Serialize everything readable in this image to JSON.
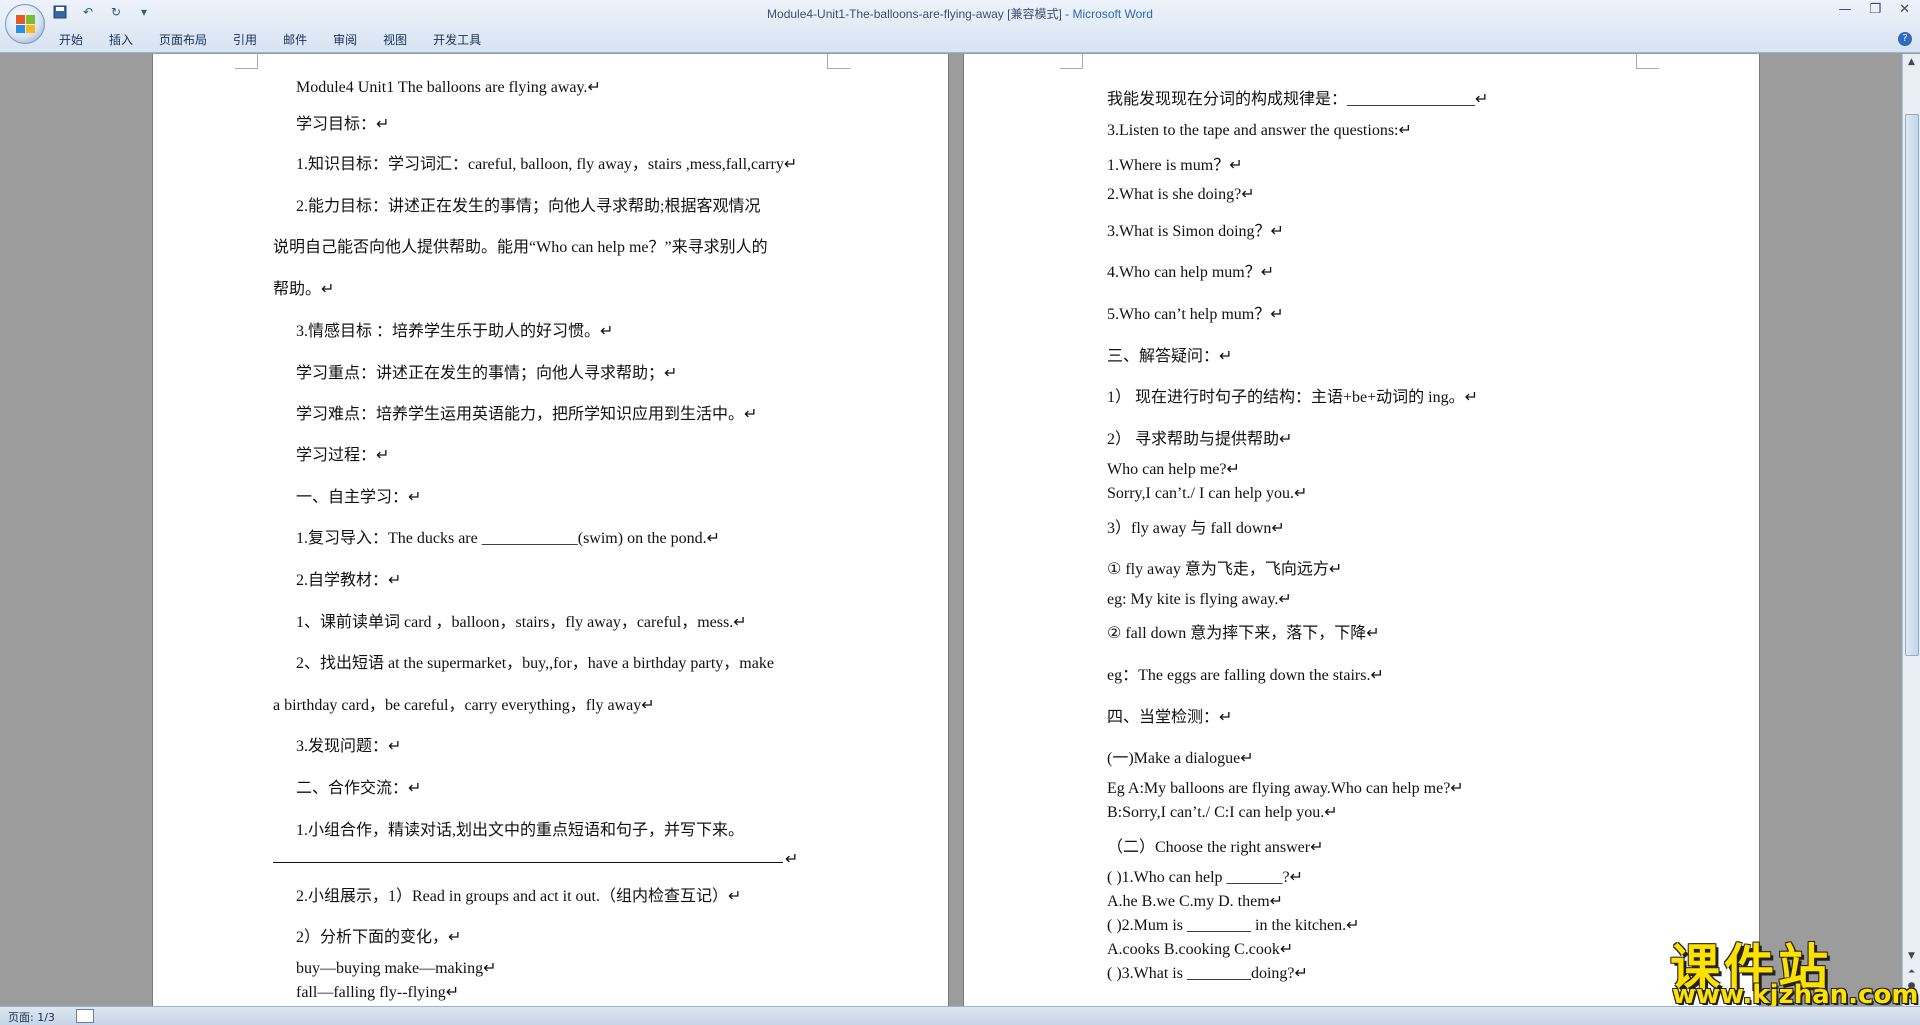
{
  "window": {
    "title": "Module4-Unit1-The-balloons-are-flying-away [兼容模式] - ",
    "app_name": "Microsoft Word",
    "controls": [
      "—",
      "❐",
      "✕"
    ]
  },
  "ribbon": {
    "tabs": [
      "开始",
      "插入",
      "页面布局",
      "引用",
      "邮件",
      "审阅",
      "视图",
      "开发工具"
    ],
    "help": "?"
  },
  "page1": {
    "lines": [
      "Module4 Unit1 The balloons are flying away.↵",
      "学习目标：↵",
      "1.知识目标：学习词汇：careful, balloon, fly away，stairs ,mess,fall,carry↵",
      "2.能力目标：讲述正在发生的事情；向他人寻求帮助;根据客观情况",
      "说明自己能否向他人提供帮助。能用“Who can help me？”来寻求别人的",
      "帮助。↵",
      "3.情感目标 ：培养学生乐于助人的好习惯。↵",
      "学习重点：讲述正在发生的事情；向他人寻求帮助；↵",
      "学习难点：培养学生运用英语能力，把所学知识应用到生活中。↵",
      "学习过程：↵",
      "一、自主学习：↵",
      "1.复习导入：The ducks are ____________(swim) on the pond.↵",
      "2.自学教材：↵",
      "1、课前读单词 card ，balloon，stairs，fly away，careful，mess.↵",
      "2、找出短语 at the supermarket，buy,,for，have a birthday party，make",
      "a birthday card，be careful，carry everything，fly away↵",
      "3.发现问题：↵",
      "二、合作交流：↵",
      "1.小组合作，精读对话,划出文中的重点短语和句子，并写下来。",
      "↵",
      "2.小组展示，1）Read in groups and act it out.（组内检查互记）↵",
      "2）分析下面的变化，↵",
      "buy—buying make—making↵",
      "fall—falling fly--flying↵"
    ]
  },
  "page2": {
    "lines": [
      "我能发现现在分词的构成规律是：________________↵",
      "3.Listen to the tape and answer the questions:↵",
      "1.Where is mum？↵",
      "2.What is she doing?↵",
      "3.What is Simon doing？↵",
      "4.Who can help mum？↵",
      "5.Who can’t help mum？↵",
      "三、解答疑问：↵",
      "1） 现在进行时句子的结构：主语+be+动词的 ing。↵",
      "2） 寻求帮助与提供帮助↵",
      "Who can help me?↵",
      "Sorry,I can’t./ I can help you.↵",
      "3）fly away 与 fall down↵",
      "① fly away 意为飞走，飞向远方↵",
      "eg: My kite is flying away.↵",
      "② fall down 意为摔下来，落下，下降↵",
      "eg：The eggs are falling down the stairs.↵",
      "四、当堂检测：↵",
      "(一)Make a dialogue↵",
      "Eg A:My balloons are flying away.Who can help me?↵",
      "B:Sorry,I can’t./ C:I can help you.↵",
      "（二）Choose the right answer↵",
      "( )1.Who can help _______?↵",
      "A.he B.we C.my D. them↵",
      "( )2.Mum is ________ in the kitchen.↵",
      "A.cooks B.cooking C.cook↵",
      "( )3.What is ________doing?↵"
    ]
  },
  "status": {
    "page_info": "页面: 1/3"
  },
  "watermark": {
    "text": "课件站",
    "url": "www.kjzhan.com"
  }
}
